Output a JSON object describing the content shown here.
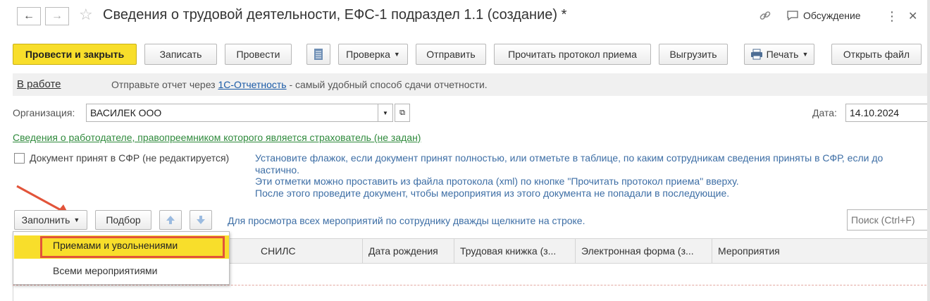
{
  "header": {
    "back_label": "←",
    "forward_label": "→",
    "star_icon": "☆",
    "title": "Сведения о трудовой деятельности, ЕФС-1 подраздел 1.1 (создание) *",
    "link_icon": "link-icon",
    "discussion_label": "Обсуждение",
    "more_label": "⋮",
    "close_label": "✕"
  },
  "toolbar": {
    "post_close": "Провести и закрыть",
    "save": "Записать",
    "post": "Провести",
    "check": "Проверка",
    "send": "Отправить",
    "read_protocol": "Прочитать протокол приема",
    "export": "Выгрузить",
    "print": "Печать",
    "open_file": "Открыть файл"
  },
  "status_bar": {
    "status": "В работе",
    "text_before": "Отправьте отчет через ",
    "link": "1С-Отчетность",
    "text_after": " - самый удобный способ сдачи отчетности."
  },
  "form": {
    "org_label": "Организация:",
    "org_value": "ВАСИЛЕК ООО",
    "date_label": "Дата:",
    "date_value": "14.10.2024",
    "employer_link": "Сведения о работодателе, правопреемником которого является страхователь (не задан)",
    "accepted_label": "Документ принят в СФР (не редактируется)",
    "info_lines": [
      "Установите флажок, если документ принят полностью, или отметьте в таблице, по каким сотрудникам сведения приняты в СФР, если до",
      "частично.",
      "Эти отметки можно проставить из файла протокола (xml) по кнопке \"Прочитать протокол приема\" вверху.",
      "После этого проведите документ, чтобы мероприятия из этого документа не попадали в последующие."
    ]
  },
  "table_toolbar": {
    "fill": "Заполнить",
    "select": "Подбор",
    "hint": "Для просмотра всех мероприятий по сотруднику дважды щелкните на строке.",
    "search_placeholder": "Поиск (Ctrl+F)"
  },
  "dropdown": {
    "items": [
      "Приемами и увольнениями",
      "Всеми мероприятиями"
    ]
  },
  "table": {
    "columns": [
      "СНИЛС",
      "Дата рождения",
      "Трудовая книжка (з...",
      "Электронная форма (з...",
      "Мероприятия"
    ]
  },
  "colors": {
    "primary_button": "#f8de2b",
    "link": "#1a5aa6",
    "employer_link": "#2f8a3c",
    "info_text": "#3d6ea5",
    "highlight_row": "#f8de2b",
    "annotation": "#e2543a"
  }
}
